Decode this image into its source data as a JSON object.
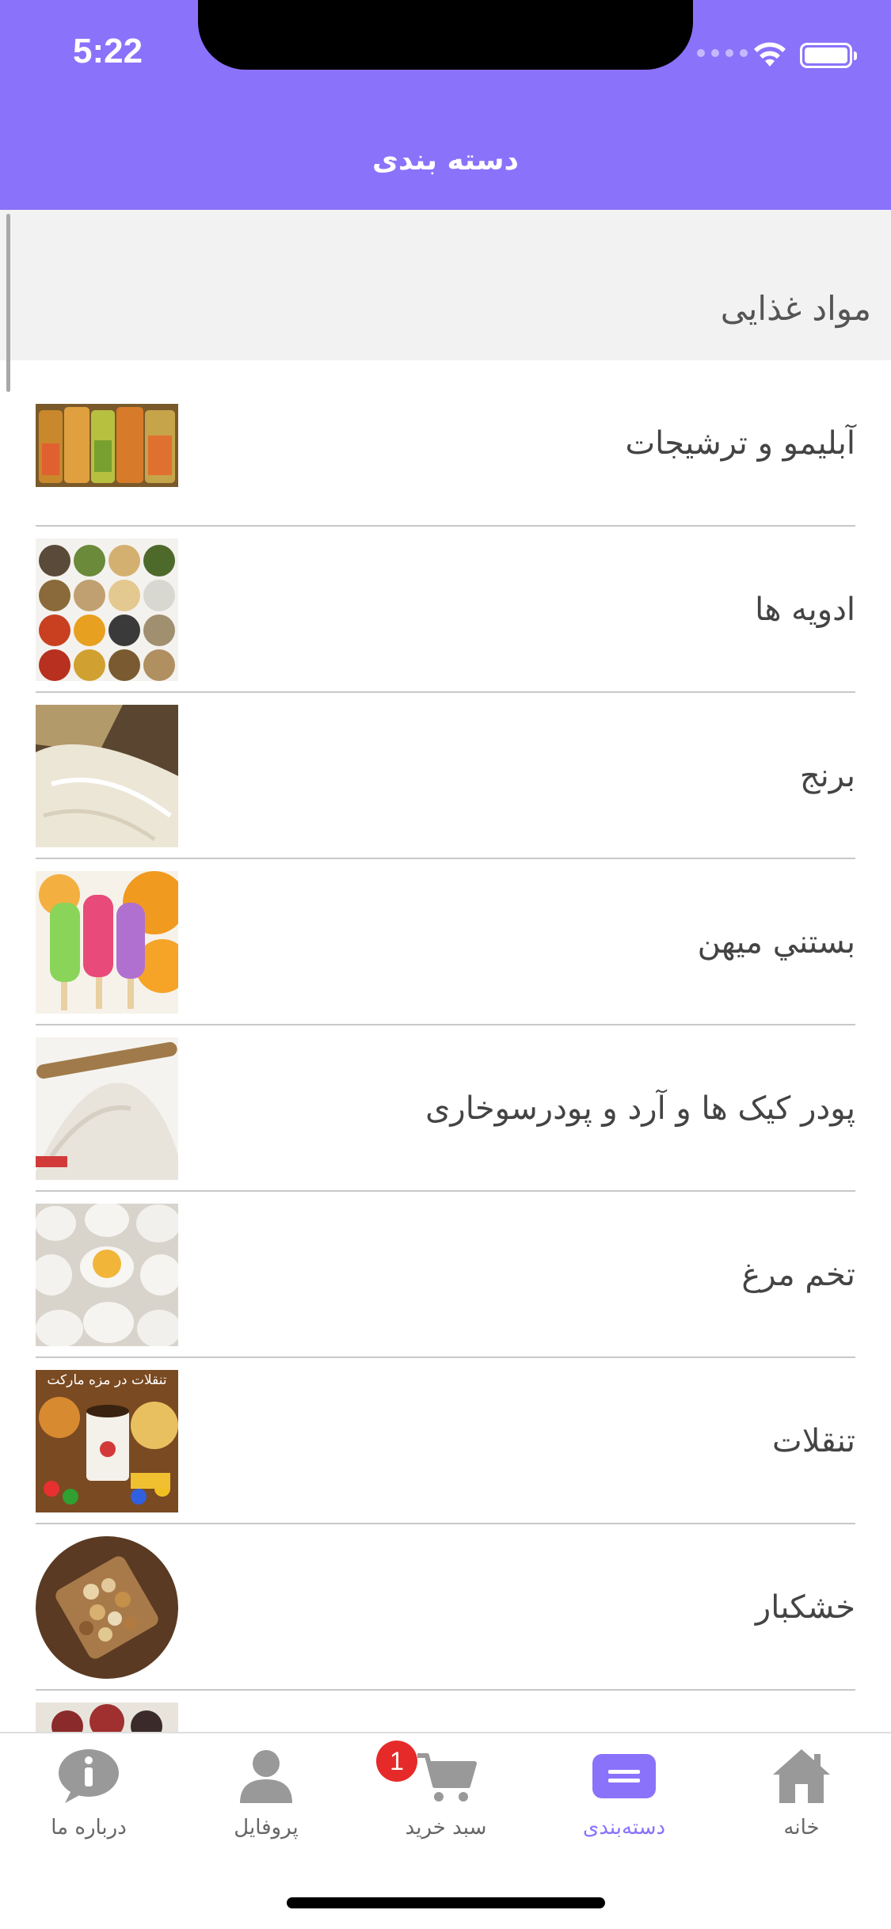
{
  "status_bar": {
    "time": "5:22"
  },
  "nav": {
    "title": "دسته بندی"
  },
  "section": {
    "title": "مواد غذایی"
  },
  "categories": [
    {
      "label": "آبلیمو و ترشیجات",
      "image": "pickle-jars-image"
    },
    {
      "label": "ادویه ها",
      "image": "spices-image"
    },
    {
      "label": "برنج",
      "image": "rice-sack-image"
    },
    {
      "label": "بستني ميهن",
      "image": "ice-cream-image"
    },
    {
      "label": "پودر کیک ها و آرد و پودرسوخاری",
      "image": "flour-image"
    },
    {
      "label": "تخم مرغ",
      "image": "eggs-image"
    },
    {
      "label": "تنقلات",
      "image": "snacks-image",
      "image_caption": "تنقلات در مزه مارکت"
    },
    {
      "label": "خشکبار",
      "image": "nuts-image"
    }
  ],
  "tabbar": {
    "tabs": [
      {
        "label": "درباره ما",
        "icon": "info-icon",
        "active": false
      },
      {
        "label": "پروفایل",
        "icon": "user-icon",
        "active": false
      },
      {
        "label": "سبد خرید",
        "icon": "cart-icon",
        "active": false
      },
      {
        "label": "دسته‌بندی",
        "icon": "category-icon",
        "active": true
      },
      {
        "label": "خانه",
        "icon": "home-icon",
        "active": false
      }
    ],
    "cart_badge": "1"
  },
  "colors": {
    "accent": "#8b72fb",
    "badge": "#e62a2a",
    "section_bg": "#f2f2f2"
  }
}
